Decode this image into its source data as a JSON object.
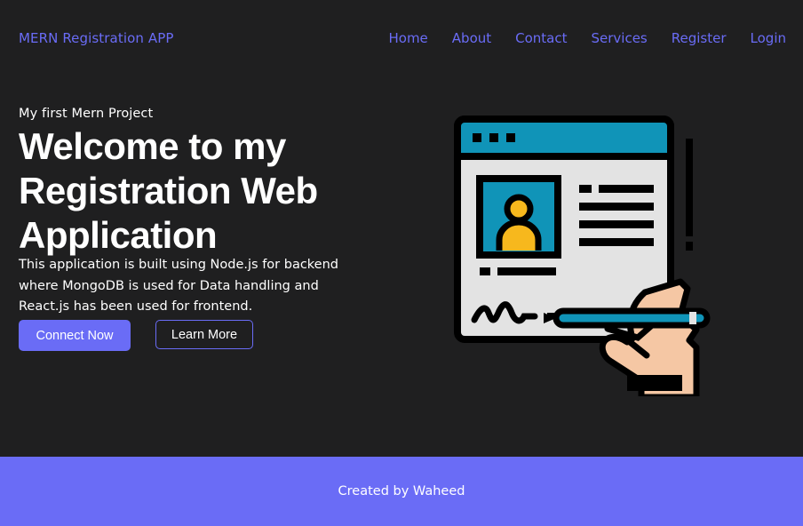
{
  "navbar": {
    "brand": "MERN Registration APP",
    "links": [
      {
        "label": "Home"
      },
      {
        "label": "About"
      },
      {
        "label": "Contact"
      },
      {
        "label": "Services"
      },
      {
        "label": "Register"
      },
      {
        "label": "Login"
      }
    ]
  },
  "hero": {
    "subtitle": "My first Mern Project",
    "title_lines": [
      "Welcome to my",
      "Registration Web",
      "Application"
    ],
    "description": "This application is built using Node.js for backend where MongoDB is used for Data handling and React.js has been used for frontend.",
    "buttons": {
      "primary": "Connect Now",
      "secondary": "Learn More"
    },
    "illustration_icon": "registration-form-signing-icon"
  },
  "footer": {
    "text": "Created by Waheed"
  },
  "colors": {
    "background": "#1f1f20",
    "accent": "#6a6cf6",
    "text": "#ffffff"
  }
}
